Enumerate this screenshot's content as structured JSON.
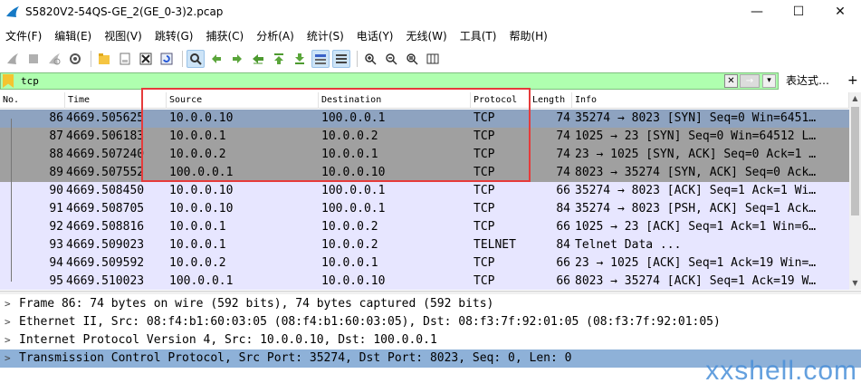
{
  "window": {
    "title": "S5820V2-54QS-GE_2(GE_0-3)2.pcap",
    "minimize": "—",
    "maximize": "☐",
    "close": "✕"
  },
  "menu": [
    "文件(F)",
    "编辑(E)",
    "视图(V)",
    "跳转(G)",
    "捕获(C)",
    "分析(A)",
    "统计(S)",
    "电话(Y)",
    "无线(W)",
    "工具(T)",
    "帮助(H)"
  ],
  "filter": {
    "value": "tcp",
    "clear": "✕",
    "apply": "→",
    "dropdown": "▾",
    "expression_label": "表达式…",
    "add": "+"
  },
  "columns": [
    "No.",
    "Time",
    "Source",
    "Destination",
    "Protocol",
    "Length",
    "Info"
  ],
  "packets": [
    {
      "no": "86",
      "time": "4669.505625",
      "src": "10.0.0.10",
      "dst": "100.0.0.1",
      "proto": "TCP",
      "len": "74",
      "info": "35274 → 8023 [SYN] Seq=0 Win=6451…"
    },
    {
      "no": "87",
      "time": "4669.506183",
      "src": "10.0.0.1",
      "dst": "10.0.0.2",
      "proto": "TCP",
      "len": "74",
      "info": "1025 → 23 [SYN] Seq=0 Win=64512 L…"
    },
    {
      "no": "88",
      "time": "4669.507240",
      "src": "10.0.0.2",
      "dst": "10.0.0.1",
      "proto": "TCP",
      "len": "74",
      "info": "23 → 1025 [SYN, ACK] Seq=0 Ack=1 …"
    },
    {
      "no": "89",
      "time": "4669.507552",
      "src": "100.0.0.1",
      "dst": "10.0.0.10",
      "proto": "TCP",
      "len": "74",
      "info": "8023 → 35274 [SYN, ACK] Seq=0 Ack…"
    },
    {
      "no": "90",
      "time": "4669.508450",
      "src": "10.0.0.10",
      "dst": "100.0.0.1",
      "proto": "TCP",
      "len": "66",
      "info": "35274 → 8023 [ACK] Seq=1 Ack=1 Wi…"
    },
    {
      "no": "91",
      "time": "4669.508705",
      "src": "10.0.0.10",
      "dst": "100.0.0.1",
      "proto": "TCP",
      "len": "84",
      "info": "35274 → 8023 [PSH, ACK] Seq=1 Ack…"
    },
    {
      "no": "92",
      "time": "4669.508816",
      "src": "10.0.0.1",
      "dst": "10.0.0.2",
      "proto": "TCP",
      "len": "66",
      "info": "1025 → 23 [ACK] Seq=1 Ack=1 Win=6…"
    },
    {
      "no": "93",
      "time": "4669.509023",
      "src": "10.0.0.1",
      "dst": "10.0.0.2",
      "proto": "TELNET",
      "len": "84",
      "info": "Telnet Data ..."
    },
    {
      "no": "94",
      "time": "4669.509592",
      "src": "10.0.0.2",
      "dst": "10.0.0.1",
      "proto": "TCP",
      "len": "66",
      "info": "23 → 1025 [ACK] Seq=1 Ack=19 Win=…"
    },
    {
      "no": "95",
      "time": "4669.510023",
      "src": "100.0.0.1",
      "dst": "10.0.0.10",
      "proto": "TCP",
      "len": "66",
      "info": "8023 → 35274 [ACK] Seq=1 Ack=19 W…"
    }
  ],
  "details": [
    "Frame 86: 74 bytes on wire (592 bits), 74 bytes captured (592 bits)",
    "Ethernet II, Src: 08:f4:b1:60:03:05 (08:f4:b1:60:03:05), Dst: 08:f3:7f:92:01:05 (08:f3:7f:92:01:05)",
    "Internet Protocol Version 4, Src: 10.0.0.10, Dst: 100.0.0.1",
    "Transmission Control Protocol, Src Port: 35274, Dst Port: 8023, Seq: 0, Len: 0"
  ],
  "expander_glyph": ">",
  "watermark": "xxshell.com",
  "colors": {
    "tcp_row": "#e7e6ff",
    "handshake_row": "#a0a0a0",
    "selected_row": "#8ea3c0",
    "filter_ok": "#afffaf",
    "highlight": "#e63b3b"
  }
}
